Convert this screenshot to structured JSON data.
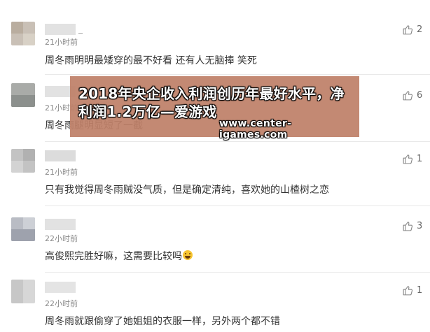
{
  "comments": [
    {
      "suffix": "_",
      "time": "21小时前",
      "text": "周冬雨明明最矮穿的最不好看 还有人无脑捧 笑死",
      "likes": "2"
    },
    {
      "suffix": "",
      "time": "21小时前",
      "text": "周冬雨腿明显短了一截",
      "likes": "6"
    },
    {
      "suffix": "",
      "time": "21小时前",
      "text": "只有我觉得周冬雨贼没气质，但是确定清纯，喜欢她的山楂树之恋",
      "likes": "1"
    },
    {
      "suffix": "",
      "time": "22小时前",
      "text": "高俊熙完胜好嘛，这需要比较吗",
      "likes": "3"
    },
    {
      "suffix": "",
      "time": "22小时前",
      "text": "周冬雨就跟偷穿了她姐姐的衣服一样，另外两个都不错",
      "likes": "1"
    }
  ],
  "banner": {
    "title": "2018年央企收入利润创历年最好水平，净利润1.2万亿—爱游戏",
    "url": "www.center-igames.com"
  },
  "colors": {
    "banner_bg": "#be8068",
    "text": "#333333",
    "meta": "#8a8a8a"
  },
  "icons": {
    "like": "thumbs-up-icon",
    "laugh": "laughing-emoji-icon"
  }
}
